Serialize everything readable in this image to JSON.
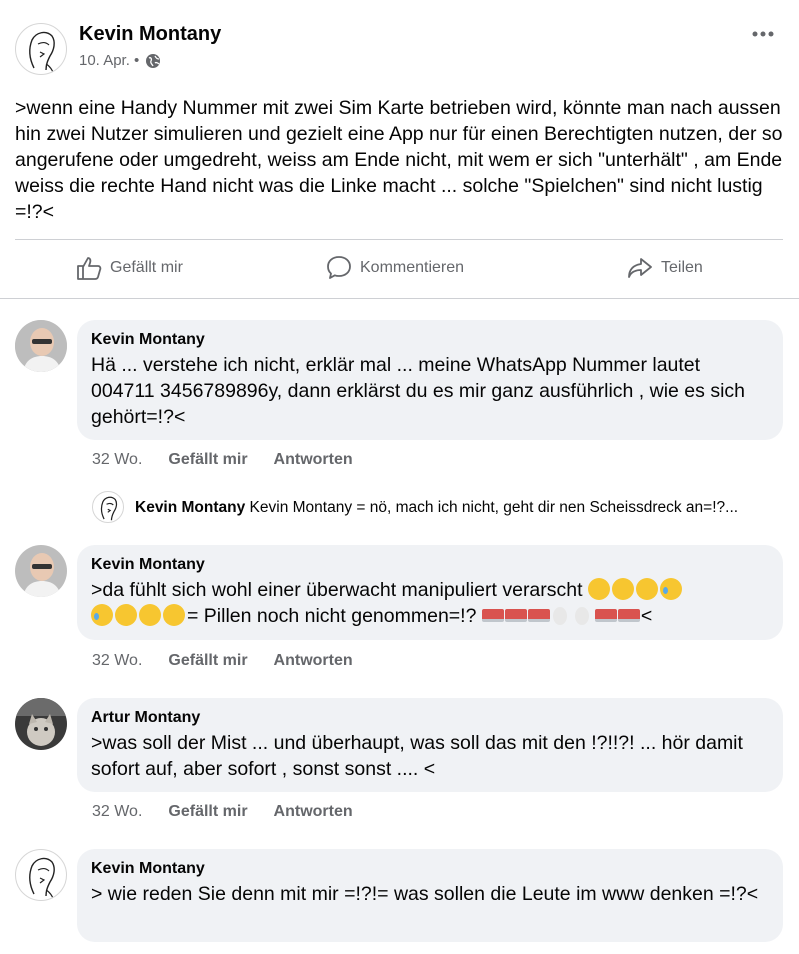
{
  "post": {
    "author": "Kevin Montany",
    "date": "10. Apr. •",
    "text": ">wenn eine Handy Nummer mit zwei Sim Karte betrieben wird, könnte man nach aussen hin zwei Nutzer simulieren und gezielt eine App nur für einen Berechtigten nutzen, der so angerufene oder umgedreht, weiss am Ende nicht, mit wem er sich \"unterhält\" , am Ende weiss die rechte Hand nicht was die Linke macht ... solche \"Spielchen\" sind nicht lustig =!?<",
    "more_icon": "more-horizontal-icon",
    "privacy_icon": "globe-icon"
  },
  "actions": {
    "like": "Gefällt mir",
    "comment": "Kommentieren",
    "share": "Teilen"
  },
  "comments": [
    {
      "author": "Kevin Montany",
      "text": "Hä ... verstehe ich nicht, erklär mal ... meine WhatsApp Nummer lautet 004711 3456789896y, dann erklärst du es mir ganz ausführlich , wie es sich gehört=!?<",
      "time": "32 Wo.",
      "like": "Gefällt mir",
      "reply": "Antworten"
    },
    {
      "author": "Kevin Montany",
      "text_line1": ">da fühlt sich wohl einer überwacht manipuliert verarscht",
      "text_line2": "= Pillen noch nicht genommen=!?",
      "text_end": "<",
      "time": "32 Wo.",
      "like": "Gefällt mir",
      "reply": "Antworten"
    },
    {
      "author": "Artur Montany",
      "text": ">was soll der Mist ... und überhaupt, was soll das mit den !?!!?! ... hör damit sofort auf, aber sofort , sonst sonst .... <",
      "time": "32 Wo.",
      "like": "Gefällt mir",
      "reply": "Antworten"
    },
    {
      "author": "Kevin Montany",
      "text": "> wie reden Sie denn mit mir =!?!= was sollen die Leute im www  denken =!?<"
    }
  ],
  "reply_preview": {
    "author": "Kevin Montany",
    "text": "Kevin Montany = nö, mach ich nicht, geht dir nen Scheissdreck an=!?..."
  }
}
